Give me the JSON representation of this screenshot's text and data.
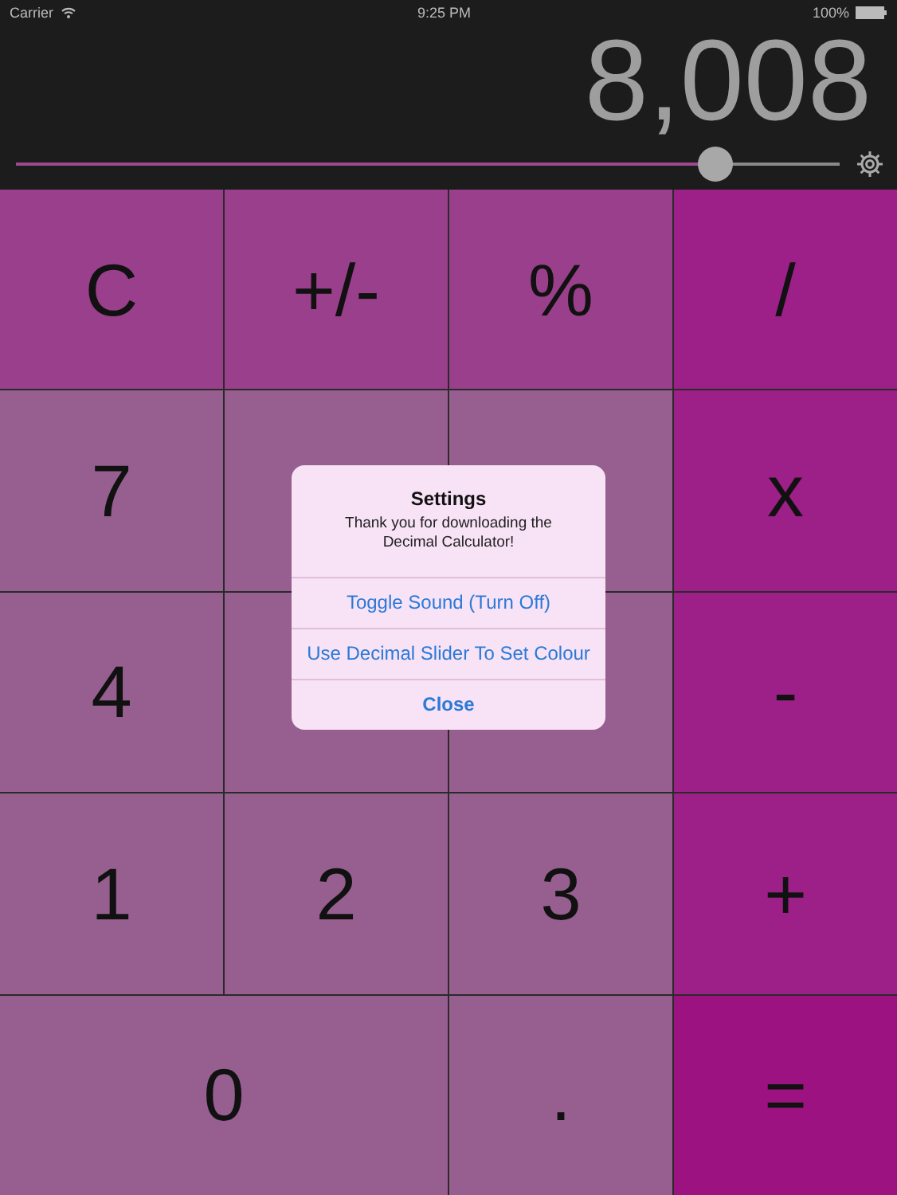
{
  "status_bar": {
    "carrier": "Carrier",
    "time": "9:25 PM",
    "battery": "100%"
  },
  "display": {
    "value": "8,008"
  },
  "colour_slider": {
    "level": 0.85
  },
  "keys": [
    {
      "label": "C",
      "kind": "function",
      "wide": false
    },
    {
      "label": "+/-",
      "kind": "function",
      "wide": false
    },
    {
      "label": "%",
      "kind": "function",
      "wide": false
    },
    {
      "label": "/",
      "kind": "operator",
      "wide": false
    },
    {
      "label": "7",
      "kind": "number",
      "wide": false
    },
    {
      "kind": "number",
      "wide": false
    },
    {
      "kind": "number",
      "wide": false
    },
    {
      "label": "x",
      "kind": "operator",
      "wide": false
    },
    {
      "label": "4",
      "kind": "number",
      "wide": false
    },
    {
      "kind": "number",
      "wide": false
    },
    {
      "kind": "number",
      "wide": false
    },
    {
      "label": "-",
      "kind": "operator",
      "wide": false
    },
    {
      "label": "1",
      "kind": "number",
      "wide": false
    },
    {
      "label": "2",
      "kind": "number",
      "wide": false
    },
    {
      "label": "3",
      "kind": "number",
      "wide": false
    },
    {
      "label": "+",
      "kind": "operator",
      "wide": false
    },
    {
      "label": "0",
      "kind": "number",
      "wide": true
    },
    {
      "label": ".",
      "kind": "number",
      "wide": false
    },
    {
      "label": "=",
      "kind": "equals",
      "wide": false
    }
  ],
  "alert": {
    "title": "Settings",
    "message": "Thank you for downloading the Decimal Calculator!",
    "actions": [
      {
        "label": "Toggle Sound (Turn Off)",
        "kind": "default"
      },
      {
        "label": "Use Decimal Slider To Set Colour",
        "kind": "default"
      },
      {
        "label": "Close",
        "kind": "cancel"
      }
    ]
  }
}
